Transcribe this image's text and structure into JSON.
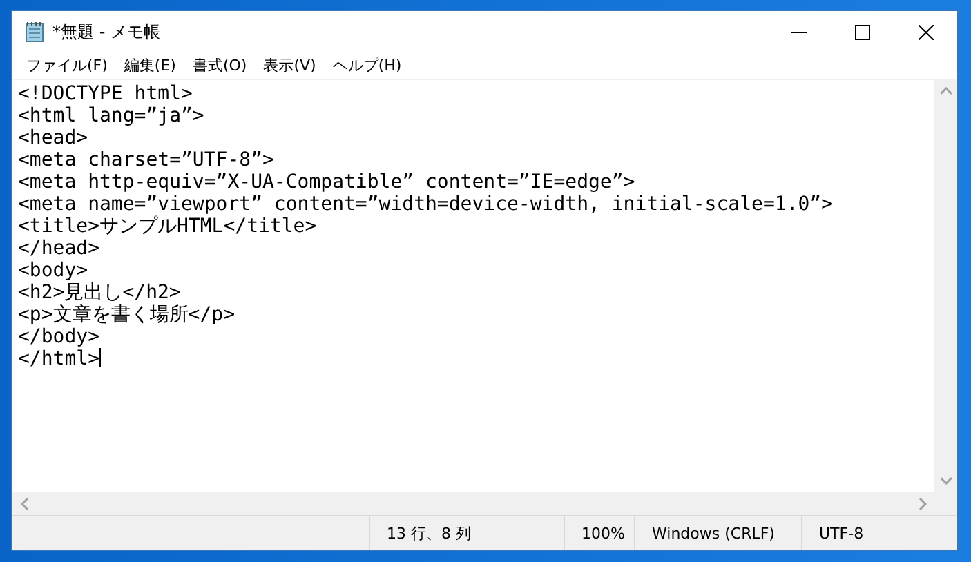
{
  "window": {
    "title": "*無題 - メモ帳"
  },
  "menu": [
    {
      "label": "ファイル(F)"
    },
    {
      "label": "編集(E)"
    },
    {
      "label": "書式(O)"
    },
    {
      "label": "表示(V)"
    },
    {
      "label": "ヘルプ(H)"
    }
  ],
  "editor": {
    "lines": [
      "<!DOCTYPE html>",
      "<html lang=”ja”>",
      "<head>",
      "<meta charset=”UTF-8”>",
      "<meta http-equiv=”X-UA-Compatible” content=”IE=edge”>",
      "<meta name=”viewport” content=”width=device-width, initial-scale=1.0”>",
      "<title>サンプルHTML</title>",
      "</head>",
      "<body>",
      "<h2>見出し</h2>",
      "<p>文章を書く場所</p>",
      "</body>",
      "</html>"
    ]
  },
  "status_bar": [
    "13 行、8 列",
    "100%",
    "Windows (CRLF)",
    "UTF-8"
  ]
}
